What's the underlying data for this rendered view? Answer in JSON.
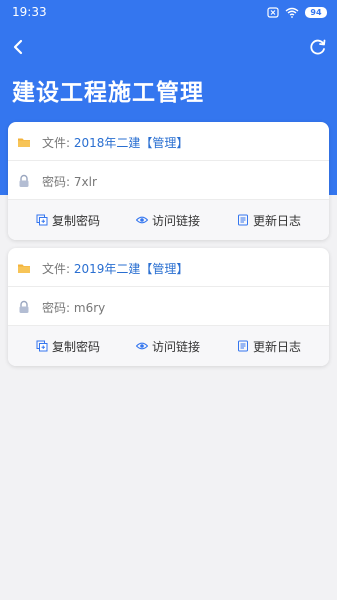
{
  "status": {
    "time": "19:33",
    "battery": "94"
  },
  "header": {
    "title": "建设工程施工管理"
  },
  "cards": [
    {
      "file_label": "文件:",
      "file_name": "2018年二建【管理】",
      "password_label": "密码:",
      "password": "7xlr"
    },
    {
      "file_label": "文件:",
      "file_name": "2019年二建【管理】",
      "password_label": "密码:",
      "password": "m6ry"
    }
  ],
  "actions": {
    "copy": "复制密码",
    "visit": "访问链接",
    "log": "更新日志"
  },
  "colors": {
    "accent": "#3476ef",
    "link": "#2a6fd1",
    "folder": "#f3b23a"
  },
  "icons": [
    "back-icon",
    "refresh-icon",
    "folder-icon",
    "lock-icon",
    "copy-icon",
    "eye-icon",
    "log-icon"
  ]
}
